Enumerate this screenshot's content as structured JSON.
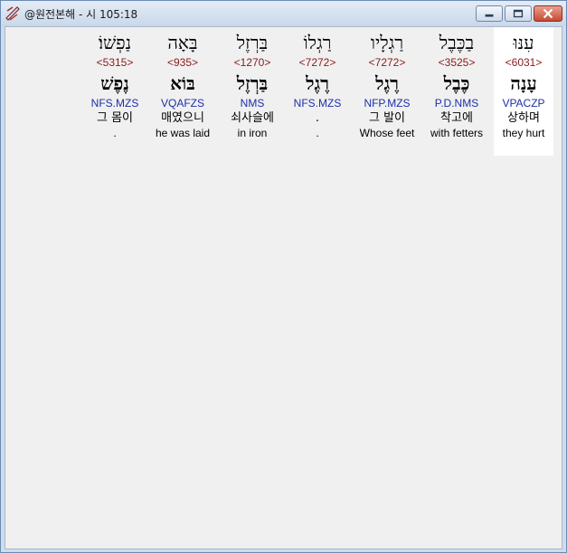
{
  "window": {
    "title": "@원전본해 - 시 105:18"
  },
  "words": [
    {
      "hebrew": "עִנּוּ",
      "strong": "<6031>",
      "lemma": "עָנָה",
      "morph": "VPACZP",
      "korean": "상하며",
      "english": "they hurt"
    },
    {
      "hebrew": "בַכֶּבֶל",
      "strong": "<3525>",
      "lemma": "כֶּבֶל",
      "morph": "P.D.NMS",
      "korean": "착고에",
      "english": "with fetters"
    },
    {
      "hebrew": "רַגְלָיו",
      "strong": "<7272>",
      "lemma": "רֶגֶל",
      "morph": "NFP.MZS",
      "korean": "그 발이",
      "english": "Whose feet"
    },
    {
      "hebrew": "רַגְלוֹ",
      "strong": "<7272>",
      "lemma": "רֶגֶל",
      "morph": "NFS.MZS",
      "korean": ".",
      "english": "."
    },
    {
      "hebrew": "בַּרְזֶל",
      "strong": "<1270>",
      "lemma": "בַּרְזֶל",
      "morph": "NMS",
      "korean": "쇠사슬에",
      "english": "in iron"
    },
    {
      "hebrew": "בָּאָה",
      "strong": "<935>",
      "lemma": "בּוֹא",
      "morph": "VQAFZS",
      "korean": "매였으니",
      "english": "he was laid"
    },
    {
      "hebrew": "נַפְשׁוֹ׃",
      "strong": "<5315>",
      "lemma": "נֶפֶשׁ",
      "morph": "NFS.MZS",
      "korean": "그 몸이",
      "english": "."
    }
  ]
}
